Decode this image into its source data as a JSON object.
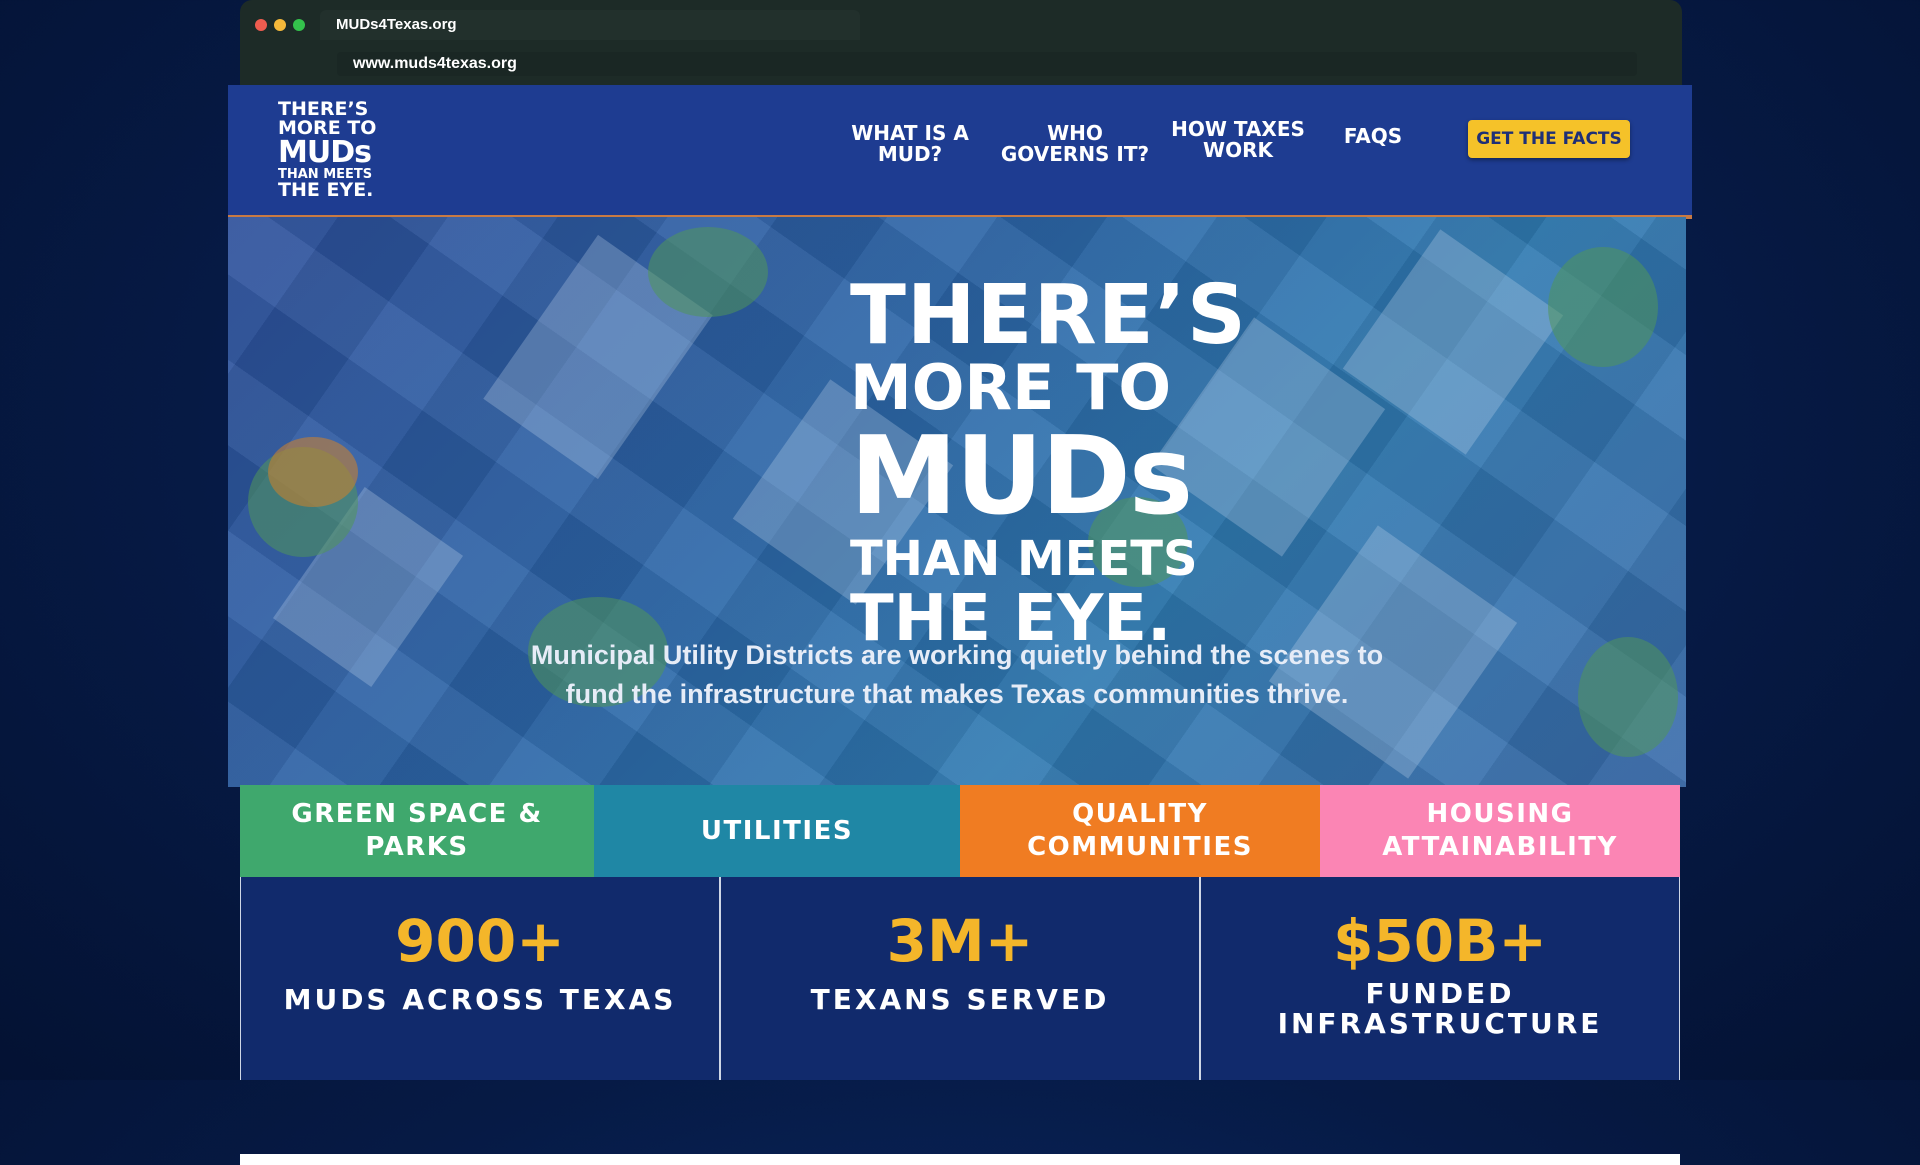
{
  "browser": {
    "tab_title": "MUDs4Texas.org",
    "url": "www.muds4texas.org",
    "dots": [
      "#ee5c4f",
      "#f5b93a",
      "#34c24c"
    ]
  },
  "logo": {
    "line1": "THERE’S",
    "line2": "MORE TO",
    "line3": "MUDs",
    "line4": "THAN MEETS",
    "line5": "THE EYE."
  },
  "nav": {
    "items": [
      {
        "line1": "WHAT IS A",
        "line2": "MUD?"
      },
      {
        "line1": "WHO",
        "line2": "GOVERNS IT?"
      },
      {
        "line1": "HOW TAXES",
        "line2": "WORK"
      },
      {
        "line1": "FAQS",
        "line2": ""
      }
    ],
    "cta": "GET THE FACTS"
  },
  "hero": {
    "title1": "THERE’S",
    "title2": "MORE TO",
    "title3": "MUDs",
    "title4": "THAN MEETS",
    "title5": "THE EYE.",
    "subtitle_line1": "Municipal Utility Districts are working quietly behind the scenes to",
    "subtitle_line2": "fund the infrastructure that makes Texas communities thrive."
  },
  "categories": [
    {
      "line1": "GREEN SPACE & PARKS",
      "line2": "",
      "color": "#3fa86d"
    },
    {
      "line1": "UTILITIES",
      "line2": "",
      "color": "#1f87a5"
    },
    {
      "line1": "QUALITY",
      "line2": "COMMUNITIES",
      "color": "#f07c22"
    },
    {
      "line1": "HOUSING",
      "line2": "ATTAINABILITY",
      "color": "#fb85b4"
    }
  ],
  "stats": [
    {
      "value": "900+",
      "label1": "MUDS ACROSS TEXAS",
      "label2": ""
    },
    {
      "value": "3M+",
      "label1": "TEXANS SERVED",
      "label2": ""
    },
    {
      "value": "$50B+",
      "label1": "FUNDED",
      "label2": "INFRASTRUCTURE"
    }
  ]
}
